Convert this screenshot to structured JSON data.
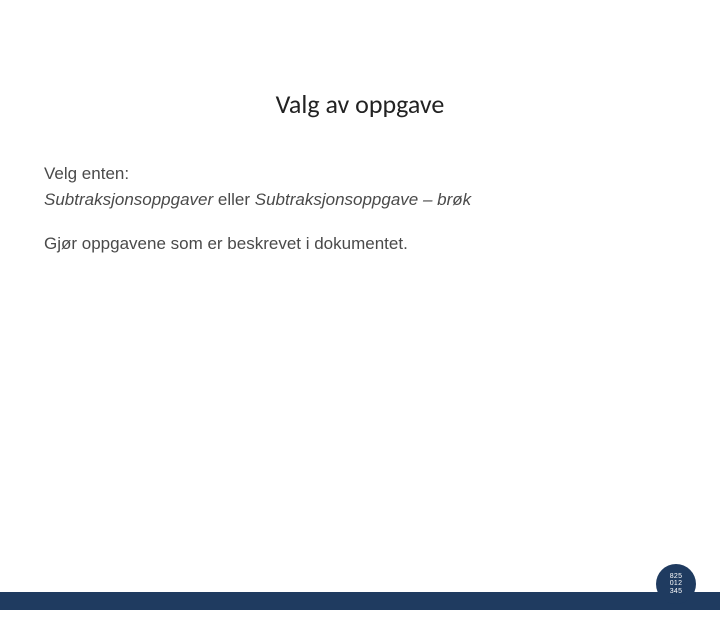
{
  "slide": {
    "title": "Valg av oppgave",
    "body": {
      "line1": "Velg enten:",
      "option1": "Subtraksjonsoppgaver",
      "connector": " eller ",
      "option2": "Subtraksjonsoppgave – brøk",
      "instruction": "Gjør oppgavene som er beskrevet i dokumentet."
    },
    "logo": {
      "row1": "825",
      "row2": "012",
      "row3": "345"
    }
  }
}
